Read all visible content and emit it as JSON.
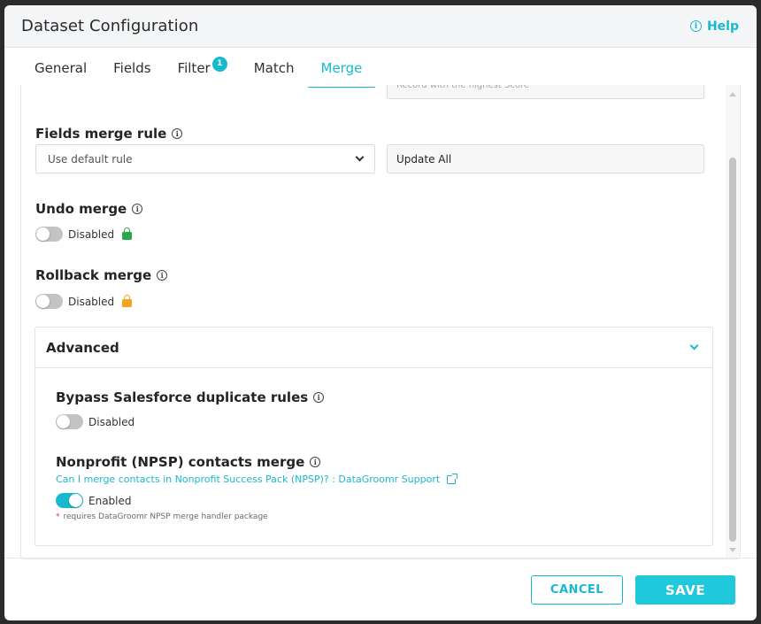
{
  "header": {
    "title": "Dataset Configuration",
    "help_label": "Help"
  },
  "tabs": [
    {
      "label": "General"
    },
    {
      "label": "Fields"
    },
    {
      "label": "Filter",
      "badge": "1"
    },
    {
      "label": "Match"
    },
    {
      "label": "Merge",
      "active": true
    }
  ],
  "merge": {
    "partial_field_text": "Record with the highest Score",
    "fields_merge_rule": {
      "label": "Fields merge rule",
      "selected": "Use default rule",
      "value": "Update All"
    },
    "undo_merge": {
      "label": "Undo merge",
      "status": "Disabled"
    },
    "rollback_merge": {
      "label": "Rollback merge",
      "status": "Disabled"
    },
    "advanced": {
      "title": "Advanced",
      "bypass": {
        "label": "Bypass Salesforce duplicate rules",
        "status": "Disabled"
      },
      "npsp": {
        "label": "Nonprofit (NPSP) contacts merge",
        "link": "Can I merge contacts in Nonprofit Success Pack (NPSP)? : DataGroomr Support",
        "status": "Enabled",
        "note": "requires DataGroomr NPSP merge handler package"
      }
    }
  },
  "footer": {
    "cancel_label": "CANCEL",
    "save_label": "SAVE"
  },
  "colors": {
    "accent": "#18b9cf",
    "lock_green": "#2aa84a",
    "lock_orange": "#f5a41f"
  }
}
